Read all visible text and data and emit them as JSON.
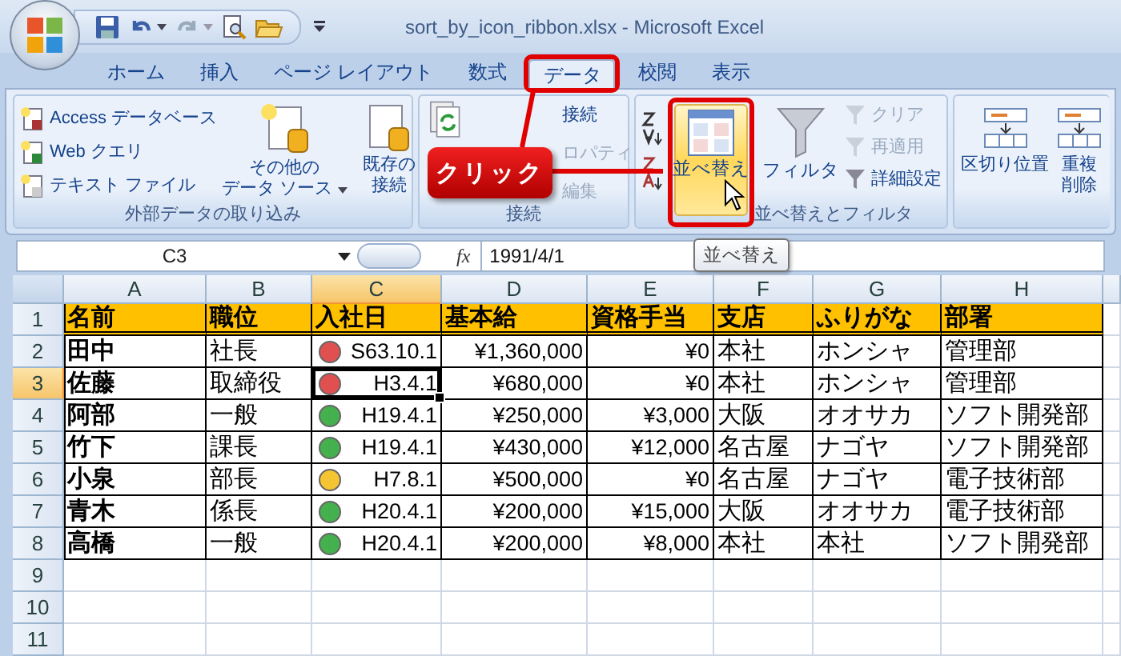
{
  "window": {
    "title": "sort_by_icon_ribbon.xlsx - Microsoft Excel"
  },
  "tabs": [
    {
      "label": "ホーム",
      "selected": false
    },
    {
      "label": "挿入",
      "selected": false
    },
    {
      "label": "ページ レイアウト",
      "selected": false
    },
    {
      "label": "数式",
      "selected": false
    },
    {
      "label": "データ",
      "selected": true
    },
    {
      "label": "校閲",
      "selected": false
    },
    {
      "label": "表示",
      "selected": false
    }
  ],
  "ribbon": {
    "external_data": {
      "label": "外部データの取り込み",
      "items": [
        "Access データベース",
        "Web クエリ",
        "テキスト ファイル"
      ],
      "other_sources": [
        "その他の",
        "データ ソース"
      ],
      "existing": [
        "既存の",
        "接続"
      ]
    },
    "connections": {
      "label": "接続",
      "items": [
        {
          "label": "接続",
          "disabled": false
        },
        {
          "label": "ロパティ",
          "disabled": true
        },
        {
          "label": "編集",
          "disabled": true
        }
      ]
    },
    "sort_filter": {
      "label": "並べ替えとフィルタ",
      "sort_button": {
        "label": "並べ替え",
        "hovered": true
      },
      "filter_button": "フィルタ",
      "items": [
        {
          "label": "クリア",
          "disabled": true
        },
        {
          "label": "再適用",
          "disabled": true
        },
        {
          "label": "詳細設定",
          "disabled": false
        }
      ]
    },
    "data_tools": {
      "buttons": [
        [
          "区切り位置"
        ],
        [
          "重複",
          "削除"
        ]
      ]
    }
  },
  "callout": "クリック",
  "tooltip": "並べ替え",
  "formula_bar": {
    "name_box": "C3",
    "fx": "fx",
    "formula": "1991/4/1"
  },
  "columns": [
    {
      "label": "A",
      "selected": false
    },
    {
      "label": "B",
      "selected": false
    },
    {
      "label": "C",
      "selected": true
    },
    {
      "label": "D",
      "selected": false
    },
    {
      "label": "E",
      "selected": false
    },
    {
      "label": "F",
      "selected": false
    },
    {
      "label": "G",
      "selected": false
    },
    {
      "label": "H",
      "selected": false
    }
  ],
  "rows": [
    {
      "number": "1",
      "kind": "header",
      "selected": false,
      "cells": [
        "名前",
        "職位",
        "入社日",
        "基本給",
        "資格手当",
        "支店",
        "ふりがな",
        "部署"
      ]
    },
    {
      "number": "2",
      "kind": "data",
      "selected": false,
      "color": "#e05050",
      "cells": [
        "田中",
        "社長",
        "S63.10.1",
        "¥1,360,000",
        "¥0",
        "本社",
        "ホンシャ",
        "管理部"
      ]
    },
    {
      "number": "3",
      "kind": "data",
      "selected": true,
      "color": "#e05050",
      "cells": [
        "佐藤",
        "取締役",
        "H3.4.1",
        "¥680,000",
        "¥0",
        "本社",
        "ホンシャ",
        "管理部"
      ]
    },
    {
      "number": "4",
      "kind": "data",
      "selected": false,
      "color": "#45b04e",
      "cells": [
        "阿部",
        "一般",
        "H19.4.1",
        "¥250,000",
        "¥3,000",
        "大阪",
        "オオサカ",
        "ソフト開発部"
      ]
    },
    {
      "number": "5",
      "kind": "data",
      "selected": false,
      "color": "#45b04e",
      "cells": [
        "竹下",
        "課長",
        "H19.4.1",
        "¥430,000",
        "¥12,000",
        "名古屋",
        "ナゴヤ",
        "ソフト開発部"
      ]
    },
    {
      "number": "6",
      "kind": "data",
      "selected": false,
      "color": "#f5c531",
      "cells": [
        "小泉",
        "部長",
        "H7.8.1",
        "¥500,000",
        "¥0",
        "名古屋",
        "ナゴヤ",
        "電子技術部"
      ]
    },
    {
      "number": "7",
      "kind": "data",
      "selected": false,
      "color": "#45b04e",
      "cells": [
        "青木",
        "係長",
        "H20.4.1",
        "¥200,000",
        "¥15,000",
        "大阪",
        "オオサカ",
        "電子技術部"
      ]
    },
    {
      "number": "8",
      "kind": "data",
      "selected": false,
      "color": "#45b04e",
      "cells": [
        "高橋",
        "一般",
        "H20.4.1",
        "¥200,000",
        "¥8,000",
        "本社",
        "本社",
        "ソフト開発部"
      ]
    },
    {
      "number": "9",
      "kind": "empty",
      "selected": false
    },
    {
      "number": "10",
      "kind": "empty",
      "selected": false
    },
    {
      "number": "11",
      "kind": "empty",
      "selected": false
    }
  ]
}
